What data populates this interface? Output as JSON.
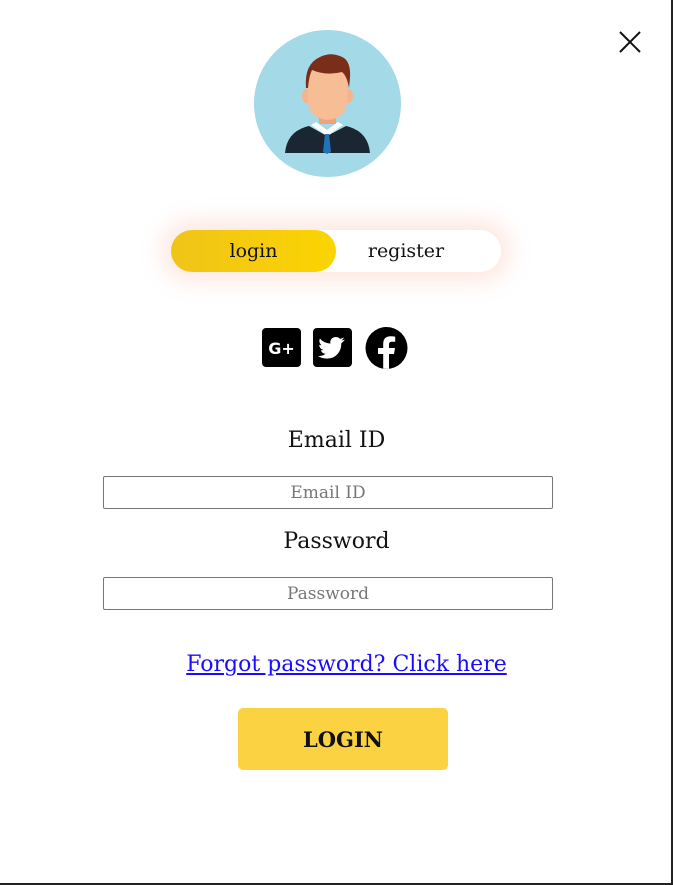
{
  "toggle": {
    "login_label": "login",
    "register_label": "register",
    "active": "login"
  },
  "social": [
    {
      "icon": "google-plus-icon"
    },
    {
      "icon": "twitter-icon"
    },
    {
      "icon": "facebook-icon"
    }
  ],
  "form": {
    "email_label": "Email ID",
    "email_placeholder": "Email ID",
    "email_value": "",
    "password_label": "Password",
    "password_placeholder": "Password",
    "password_value": "",
    "forgot_link": "Forgot password? Click here",
    "submit_label": "LOGIN"
  },
  "icons": {
    "close": "close-icon",
    "avatar": "user-avatar-icon"
  },
  "colors": {
    "accent": "#fbd241",
    "toggle_active": "#f7cf0d",
    "avatar_bg": "#a4d9e8",
    "link": "#1a0dff"
  }
}
